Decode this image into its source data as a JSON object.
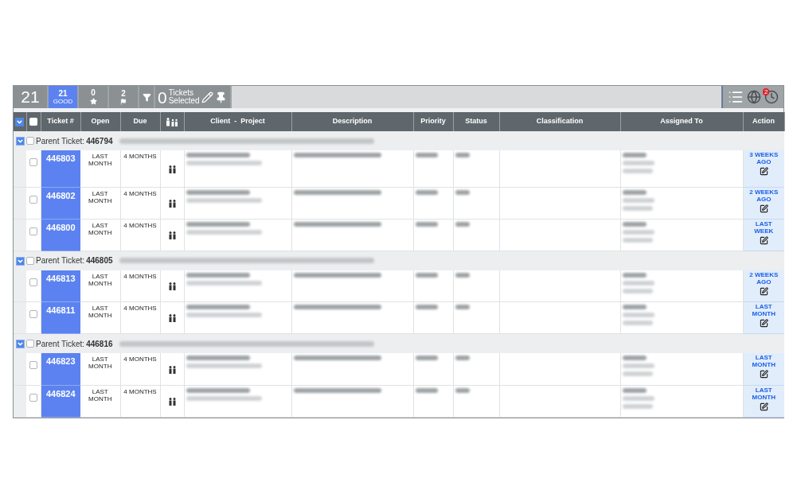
{
  "toolbar": {
    "total": "21",
    "counters": [
      {
        "kind": "count",
        "value": "21",
        "label": "GOOD",
        "selected": true
      },
      {
        "kind": "star",
        "value": "0",
        "selected": false
      },
      {
        "kind": "flag",
        "value": "2",
        "selected": false
      }
    ],
    "selected_count": "0",
    "selected_label_1": "Tickets",
    "selected_label_2": "Selected",
    "alert_badge": "2"
  },
  "table": {
    "all_checked": false,
    "columns": [
      "Ticket #",
      "Open",
      "Due",
      "Client  -  Project",
      "Description",
      "Priority",
      "Status",
      "Classification",
      "Assigned To",
      "Action"
    ],
    "groups": [
      {
        "label": "Parent Ticket:",
        "id": "446794",
        "expanded": true,
        "checked": false,
        "rows": [
          {
            "ticket": "446803",
            "open": "LAST MONTH",
            "due": "4 MONTHS",
            "action": "3 WEEKS AGO",
            "checked": false
          },
          {
            "ticket": "446802",
            "open": "LAST MONTH",
            "due": "4 MONTHS",
            "action": "2 WEEKS AGO",
            "checked": false
          },
          {
            "ticket": "446800",
            "open": "LAST MONTH",
            "due": "4 MONTHS",
            "action": "LAST WEEK",
            "checked": false
          }
        ]
      },
      {
        "label": "Parent Ticket:",
        "id": "446805",
        "expanded": true,
        "checked": false,
        "rows": [
          {
            "ticket": "446813",
            "open": "LAST MONTH",
            "due": "4 MONTHS",
            "action": "2 WEEKS AGO",
            "checked": false
          },
          {
            "ticket": "446811",
            "open": "LAST MONTH",
            "due": "4 MONTHS",
            "action": "LAST MONTH",
            "checked": false
          }
        ]
      },
      {
        "label": "Parent Ticket:",
        "id": "446816",
        "expanded": true,
        "checked": false,
        "rows": [
          {
            "ticket": "446823",
            "open": "LAST MONTH",
            "due": "4 MONTHS",
            "action": "LAST MONTH",
            "checked": false
          },
          {
            "ticket": "446824",
            "open": "LAST MONTH",
            "due": "4 MONTHS",
            "action": "LAST MONTH",
            "checked": false
          }
        ]
      }
    ]
  }
}
